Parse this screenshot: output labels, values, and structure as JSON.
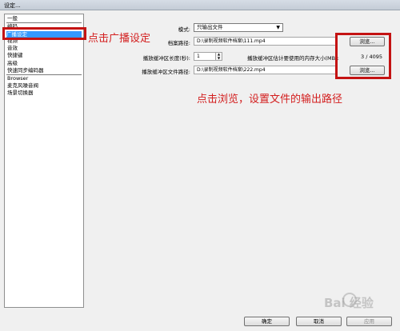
{
  "window": {
    "title": "设定..."
  },
  "sidebar": {
    "items": [
      {
        "label": "一般"
      },
      {
        "label": "编码"
      },
      {
        "label": "广播设定"
      },
      {
        "label": "视频"
      },
      {
        "label": "音效"
      },
      {
        "label": "快捷键"
      },
      {
        "label": "高级"
      },
      {
        "label": "快速同步编码器"
      },
      {
        "label": "Browser"
      },
      {
        "label": "麦克风噪音阀"
      },
      {
        "label": "场景切换器"
      }
    ]
  },
  "annotations": {
    "click_broadcast": "点击广播设定",
    "click_browse": "点击浏览，设置文件的输出路径"
  },
  "form": {
    "mode_label": "模式:",
    "mode_value": "只输出文件",
    "file_path_label": "档案路径:",
    "file_path_value": "D:\\录制视频软件档案\\111.mp4",
    "browse_label": "浏览...",
    "buffer_length_label": "播放缓冲区长度(秒):",
    "buffer_length_value": "1",
    "memory_label": "播放缓冲区估计要使用的内存大小(MB):",
    "memory_value": "3 / 4095",
    "buffer_path_label": "播放缓冲区文件路径:",
    "buffer_path_value": "D:\\录制视频软件档案\\222.mp4",
    "browse2_label": "浏览..."
  },
  "footer": {
    "ok_label": "确定",
    "cancel_label": "取消",
    "apply_label": "应用"
  },
  "watermark": {
    "text": "Bai  经验"
  },
  "colors": {
    "selection": "#3399ff",
    "annotation": "#d31e1e"
  }
}
